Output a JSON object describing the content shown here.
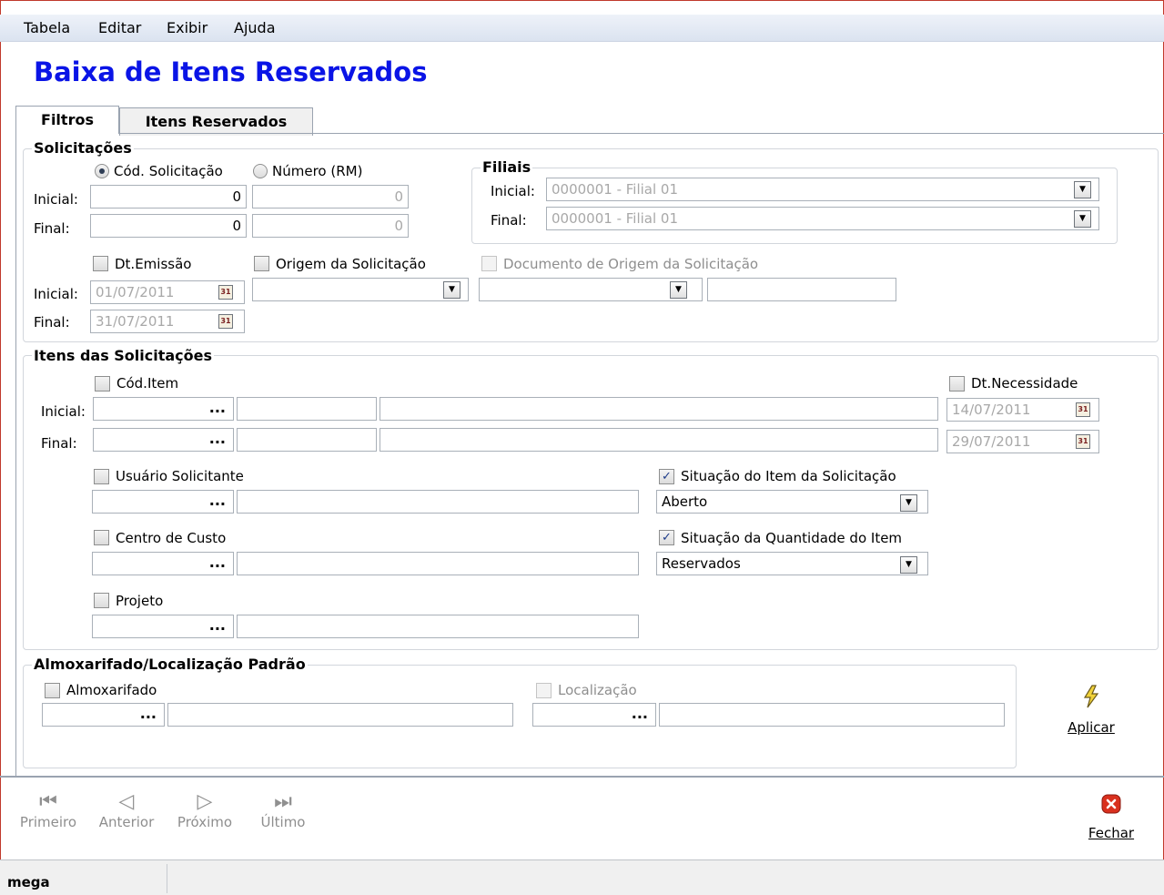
{
  "menu": [
    "Tabela",
    "Editar",
    "Exibir",
    "Ajuda"
  ],
  "title": "Baixa de Itens Reservados",
  "tabs": [
    "Filtros",
    "Itens Reservados"
  ],
  "solicitacoes": {
    "legend": "Solicitações",
    "radio_cod": "Cód. Solicitação",
    "radio_numero": "Número (RM)",
    "inicial_label": "Inicial:",
    "final_label": "Final:",
    "cod_inicial": "0",
    "cod_final": "0",
    "num_inicial": "0",
    "num_final": "0",
    "dt_emissao": "Dt.Emissão",
    "origem": "Origem da Solicitação",
    "documento": "Documento de Origem da Solicitação",
    "dt_inicial": "01/07/2011",
    "dt_final": "31/07/2011"
  },
  "filiais": {
    "legend": "Filiais",
    "inicial_label": "Inicial:",
    "final_label": "Final:",
    "inicial": "0000001 - Filial 01",
    "final": "0000001 - Filial 01"
  },
  "itens": {
    "legend": "Itens das Solicitações",
    "cod_item": "Cód.Item",
    "inicial_label": "Inicial:",
    "final_label": "Final:",
    "dt_necessidade": "Dt.Necessidade",
    "dt_nec_inicial": "14/07/2011",
    "dt_nec_final": "29/07/2011",
    "usuario": "Usuário Solicitante",
    "centro_custo": "Centro de Custo",
    "projeto": "Projeto",
    "situacao_item": "Situação do Item da Solicitação",
    "situacao_item_value": "Aberto",
    "situacao_qtd": "Situação da Quantidade do Item",
    "situacao_qtd_value": "Reservados",
    "ellipsis": "..."
  },
  "almox": {
    "legend": "Almoxarifado/Localização Padrão",
    "almoxarifado": "Almoxarifado",
    "localizacao": "Localização",
    "ellipsis": "..."
  },
  "aplicar": "Aplicar",
  "nav": [
    "Primeiro",
    "Anterior",
    "Próximo",
    "Último"
  ],
  "fechar": "Fechar",
  "status": "mega",
  "colors": {
    "title": "#0a14e6",
    "fechar_icon": "#d9301e",
    "aplicar_icon": "#e8c82a"
  }
}
